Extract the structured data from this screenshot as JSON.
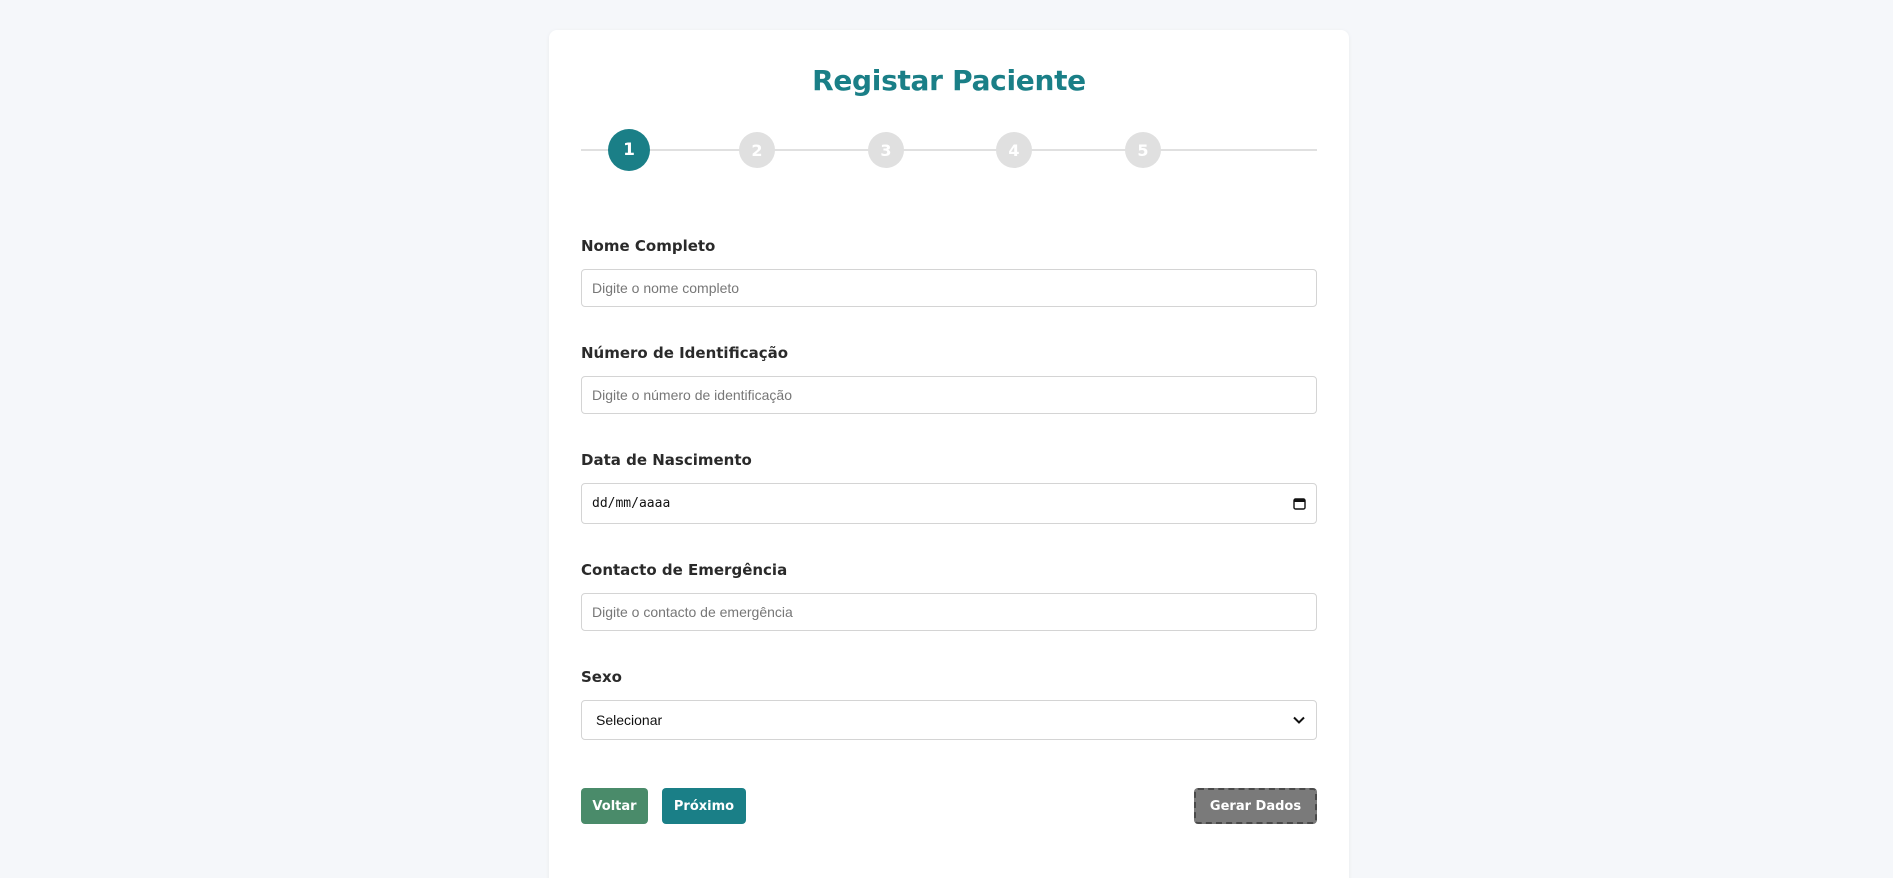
{
  "form": {
    "title": "Registar Paciente",
    "steps": [
      "1",
      "2",
      "3",
      "4",
      "5"
    ],
    "active_step": 1,
    "fields": {
      "full_name": {
        "label": "Nome Completo",
        "placeholder": "Digite o nome completo",
        "value": ""
      },
      "id_number": {
        "label": "Número de Identificação",
        "placeholder": "Digite o número de identificação",
        "value": ""
      },
      "birth_date": {
        "label": "Data de Nascimento",
        "display": "dd/mm/aaaa"
      },
      "emergency_contact": {
        "label": "Contacto de Emergência",
        "placeholder": "Digite o contacto de emergência",
        "value": ""
      },
      "sex": {
        "label": "Sexo",
        "selected": "Selecionar"
      }
    },
    "buttons": {
      "back": "Voltar",
      "next": "Próximo",
      "generate": "Gerar Dados"
    }
  },
  "colors": {
    "accent": "#1a7f87",
    "back_button": "#4a8b6a",
    "generate_button": "#7a7a7a",
    "inactive_step": "#e0e0e0"
  },
  "icons": {
    "date_picker": "calendar-icon",
    "select": "chevron-down-icon"
  }
}
